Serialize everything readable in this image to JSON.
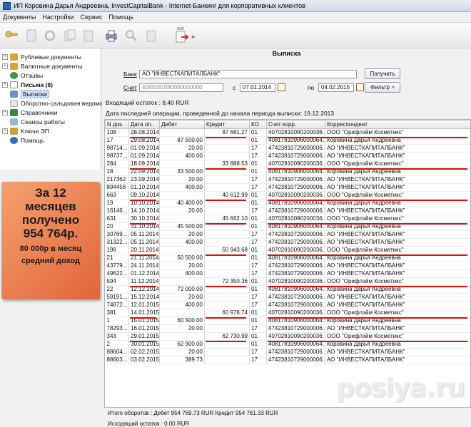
{
  "window": {
    "title": "ИП Коровина Дарья Андреевна, InvestCapitalBank - Internet-Банкинг для корпоративных клиентов"
  },
  "menu": [
    "Документы",
    "Настройки",
    "Сервис",
    "Помощь"
  ],
  "toolbar": {
    "out_label": "out"
  },
  "sidebar": {
    "items": [
      {
        "label": "Рублевые документы",
        "icon": "folder-icon"
      },
      {
        "label": "Валютные документы",
        "icon": "folder-icon"
      },
      {
        "label": "Отзывы",
        "icon": "recall-icon"
      },
      {
        "label": "Письма (8)",
        "icon": "mail-icon"
      },
      {
        "label": "Выписки",
        "icon": "statement-icon"
      },
      {
        "label": "Оборотно-сальдовая ведомость",
        "icon": "report-icon"
      },
      {
        "label": "Справочники",
        "icon": "book-icon"
      },
      {
        "label": "Сеансы работы",
        "icon": "session-icon"
      },
      {
        "label": "Ключи ЭП",
        "icon": "key-icon"
      },
      {
        "label": "Помощь",
        "icon": "help-icon"
      }
    ]
  },
  "promo": {
    "line1": "За 12",
    "line2": "месяцев",
    "line3": "получено",
    "line4": "954 764р.",
    "line5": "80 000р в месяц",
    "line6": "средний доход"
  },
  "panel": {
    "title": "Выписка",
    "bank_label": "Банк",
    "bank_value": "АО \"ИНВЕСТКАПИТАЛБАНК\"",
    "account_label": "Счет",
    "account_value": "4080281080000000000",
    "from_label": "с",
    "from_date": "07.01.2014",
    "to_label": "по",
    "to_date": "04.02.2015",
    "get_button": "Получить",
    "filter_button": "Фильтр",
    "opening_balance": "Входящий остаток :  8.40  RUR",
    "last_op_date": "Дата последней операции, проведенной до начала периода выписки: 19.12.2013"
  },
  "table": {
    "columns": [
      "N док.",
      "Дата оп.",
      "Дебет",
      "Кредит",
      "КО",
      "Счет корр.",
      "Корреспондент"
    ],
    "rows": [
      [
        "108",
        "28.08.2014",
        "",
        "87 681.27",
        "01",
        "40702810090200036...",
        "ООО \"Орифлэйм Косметикс\""
      ],
      [
        "17",
        "29.08.2014",
        "87 500.00",
        "",
        "01",
        "40817810906000064...",
        "Коровина Дарья Андреевна"
      ],
      [
        "98714...",
        "01.09.2014",
        "20.00",
        "",
        "17",
        "47423810729000006...",
        "АО \"ИНВЕСТКАПИТАЛБАНК\""
      ],
      [
        "98737...",
        "01.09.2014",
        "400.00",
        "",
        "17",
        "47423810729000006...",
        "АО \"ИНВЕСТКАПИТАЛБАНК\""
      ],
      [
        "284",
        "18.09.2014",
        "",
        "33 888.53",
        "01",
        "40702810090200036...",
        "ООО \"Орифлэйм Косметикс\""
      ],
      [
        "18",
        "22.09.2014",
        "33 500.00",
        "",
        "01",
        "40817810906000064...",
        "Коровина Дарья Андреевна"
      ],
      [
        "217362",
        "23.09.2014",
        "20.00",
        "",
        "17",
        "47423810729000006...",
        "АО \"ИНВЕСТКАПИТАЛБАНК\""
      ],
      [
        "894458",
        "01.10.2014",
        "400.00",
        "",
        "17",
        "47423810729000006...",
        "АО \"ИНВЕСТКАПИТАЛБАНК\""
      ],
      [
        "663",
        "09.10.2014",
        "",
        "40 612.99",
        "01",
        "40702810090200036...",
        "ООО \"Орифлэйм Косметикс\""
      ],
      [
        "19",
        "10.10.2014",
        "40 400.00",
        "",
        "01",
        "40817810906000064...",
        "Коровина Дарья Андреевна"
      ],
      [
        "16146...",
        "14.10.2014",
        "20.00",
        "",
        "17",
        "47423810729000006...",
        "АО \"ИНВЕСТКАПИТАЛБАНК\""
      ],
      [
        "631",
        "30.10.2014",
        "",
        "45 662.10",
        "01",
        "40702810090200036...",
        "ООО \"Орифлэйм Косметикс\""
      ],
      [
        "20",
        "31.10.2014",
        "45 500.00",
        "",
        "01",
        "40817810906000064...",
        "Коровина Дарья Андреевна"
      ],
      [
        "30769...",
        "05.11.2014",
        "20.00",
        "",
        "17",
        "47423810729000006...",
        "АО \"ИНВЕСТКАПИТАЛБАНК\""
      ],
      [
        "31322...",
        "05.11.2014",
        "400.00",
        "",
        "17",
        "47423810729000006...",
        "АО \"ИНВЕСТКАПИТАЛБАНК\""
      ],
      [
        "198",
        "20.11.2014",
        "",
        "50 943.68",
        "01",
        "40702810090200036...",
        "ООО \"Орифлэйм Косметикс\""
      ],
      [
        "21",
        "21.11.2014",
        "50 500.00",
        "",
        "01",
        "40817810906000064...",
        "Коровина Дарья Андреевна"
      ],
      [
        "43779...",
        "24.11.2014",
        "20.00",
        "",
        "17",
        "47423810729000006...",
        "АО \"ИНВЕСТКАПИТАЛБАНК\""
      ],
      [
        "49622...",
        "01.12.2014",
        "400.00",
        "",
        "17",
        "47423810729000006...",
        "АО \"ИНВЕСТКАПИТАЛБАНК\""
      ],
      [
        "594",
        "11.12.2014",
        "",
        "72 350.36",
        "01",
        "40702810090200036...",
        "ООО \"Орифлэйм Косметикс\""
      ],
      [
        "22",
        "12.12.2014",
        "72 000.00",
        "",
        "01",
        "40817810906000064...",
        "Коровина Дарья Андреевна"
      ],
      [
        "59191...",
        "15.12.2014",
        "20.00",
        "",
        "17",
        "47423810729000006...",
        "АО \"ИНВЕСТКАПИТАЛБАНК\""
      ],
      [
        "74872...",
        "12.01.2015",
        "400.00",
        "",
        "17",
        "47423810729000006...",
        "АО \"ИНВЕСТКАПИТАЛБАНК\""
      ],
      [
        "381",
        "14.01.2015",
        "",
        "60 978.74",
        "01",
        "40702810090200036...",
        "ООО \"Орифлэйм Косметикс\""
      ],
      [
        "1",
        "15.01.2015",
        "60 500.00",
        "",
        "01",
        "40817810906000064...",
        "Коровина Дарья Андреевна"
      ],
      [
        "78293...",
        "16.01.2015",
        "20.00",
        "",
        "17",
        "47423810729000006...",
        "АО \"ИНВЕСТКАПИТАЛБАНК\""
      ],
      [
        "343",
        "29.01.2015",
        "",
        "62 730.99",
        "01",
        "40702810090200036...",
        "ООО \"Орифлэйм Косметикс\""
      ],
      [
        "2",
        "30.01.2015",
        "62 900.00",
        "",
        "01",
        "40817810906000064...",
        "Коровина Дарья Андреевна"
      ],
      [
        "88604...",
        "02.02.2015",
        "20.00",
        "",
        "17",
        "47423810729000006...",
        "АО \"ИНВЕСТКАПИТАЛБАНК\""
      ],
      [
        "88603...",
        "03.02.2015",
        "389.73",
        "",
        "17",
        "47423810729000006...",
        "АО \"ИНВЕСТКАПИТАЛБАНК\""
      ]
    ],
    "highlighted_rows": [
      0,
      4,
      8,
      11,
      15,
      19,
      23,
      26
    ]
  },
  "totals": {
    "turnover": "Итого оборотов :  Дебет  954 769.73  RUR  Кредит  954 761.33  RUR",
    "closing_balance": "Исходящий остаток :  0.00  RUR"
  },
  "watermark": "posiya.ru",
  "colors": {
    "underline": "#d41212",
    "promo": "#e2643a",
    "selection": "#cfe0f7"
  }
}
